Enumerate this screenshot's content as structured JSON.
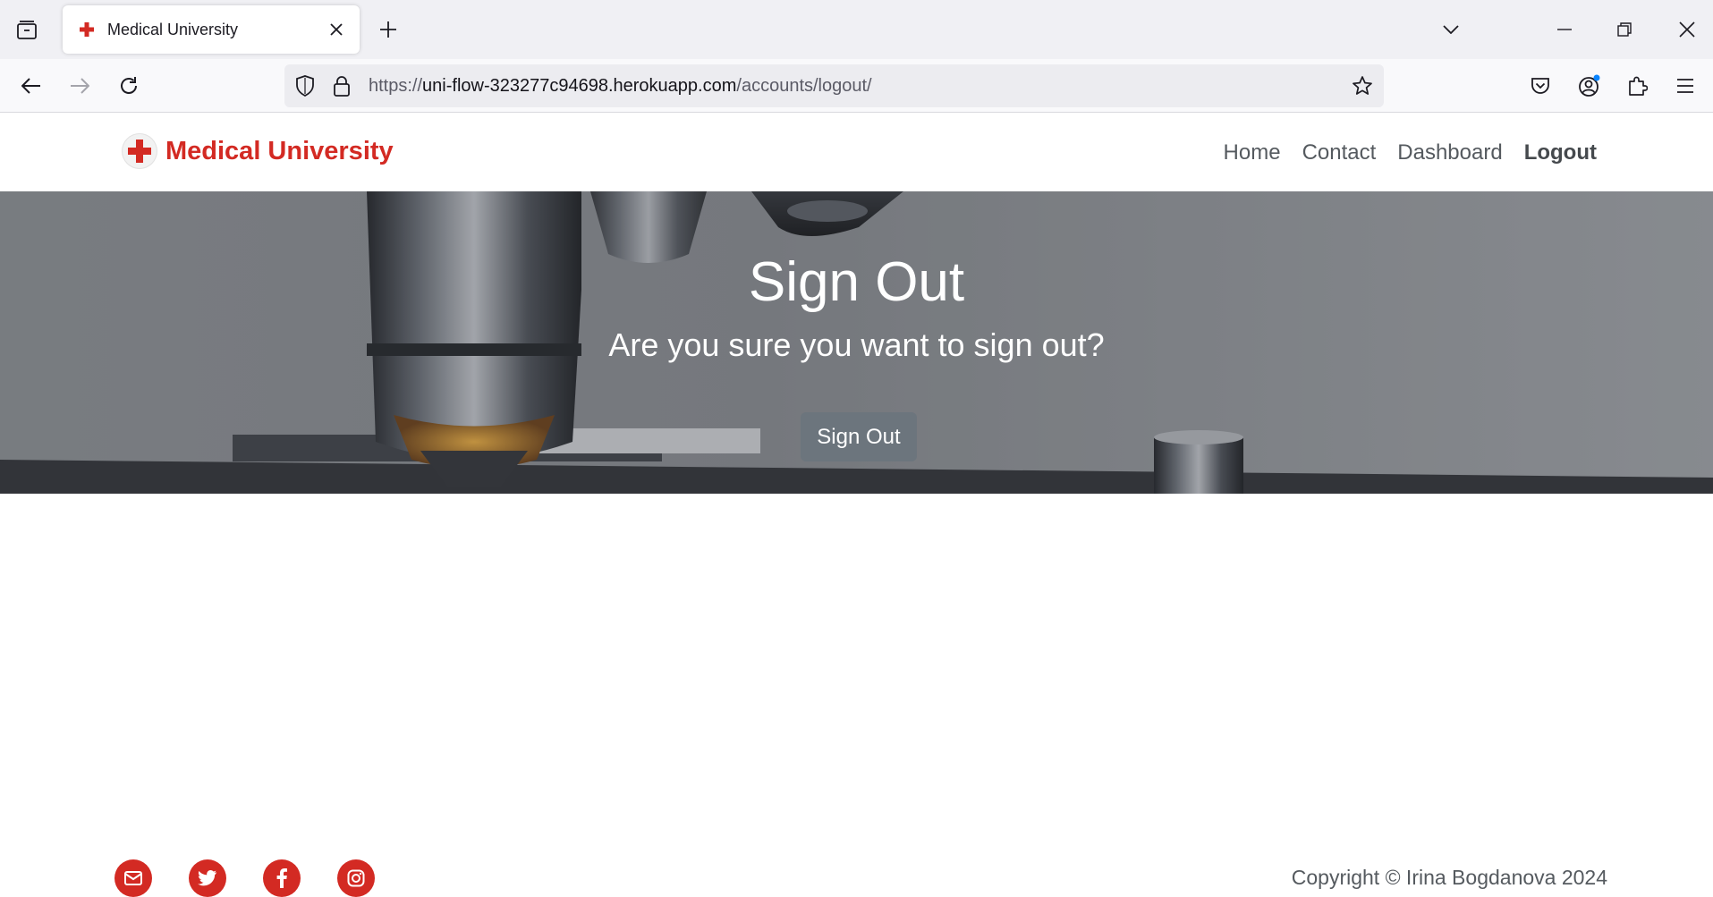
{
  "browser": {
    "tab_title": "Medical University",
    "url_prefix": "https://",
    "url_host": "uni-flow-323277c94698.herokuapp.com",
    "url_path": "/accounts/logout/"
  },
  "site": {
    "brand_name": "Medical University",
    "nav": {
      "home": "Home",
      "contact": "Contact",
      "dashboard": "Dashboard",
      "logout": "Logout"
    }
  },
  "hero": {
    "title": "Sign Out",
    "subtitle": "Are you sure you want to sign out?",
    "button_label": "Sign Out"
  },
  "footer": {
    "social_icons": [
      "envelope-icon",
      "twitter-icon",
      "facebook-icon",
      "instagram-icon"
    ],
    "copyright": "Copyright © Irina Bogdanova 2024"
  },
  "colors": {
    "brand_red": "#d32a23",
    "button_grey": "#6c757d",
    "nav_text": "#555a5f"
  }
}
